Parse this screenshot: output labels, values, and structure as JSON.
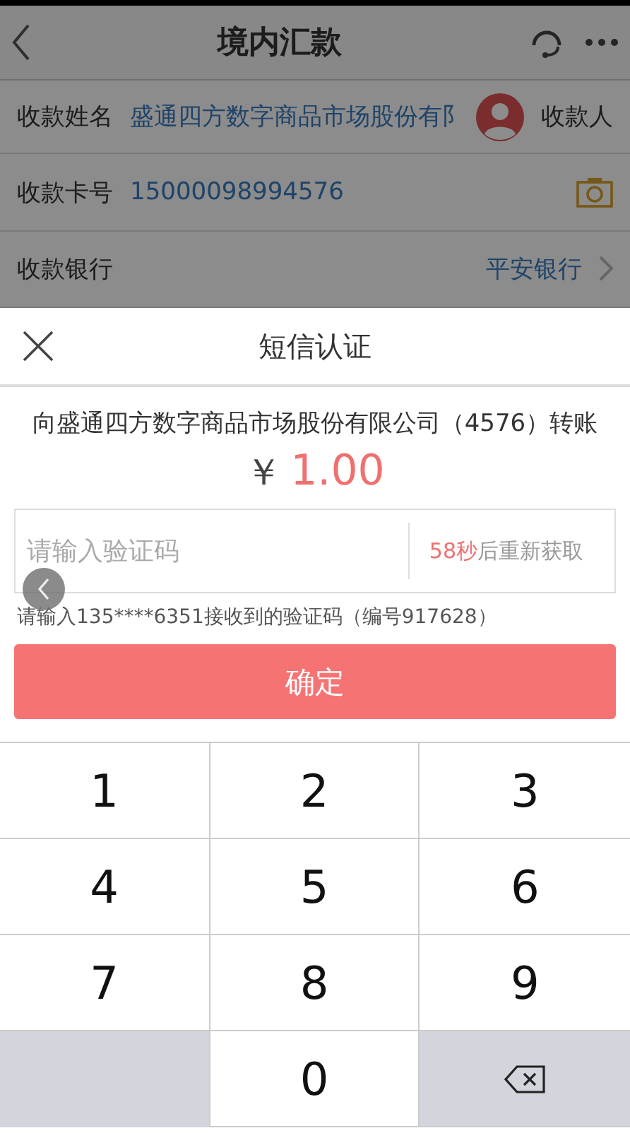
{
  "nav": {
    "title": "境内汇款"
  },
  "form_rows": [
    {
      "kind": "payee",
      "label": "收款姓名",
      "value": "盛通四方数字商品市场股份有阝",
      "action": "收款人"
    },
    {
      "kind": "card",
      "label": "收款卡号",
      "value": "15000098994576"
    },
    {
      "kind": "bank",
      "label": "收款银行",
      "value": "平安银行"
    }
  ],
  "sheet": {
    "title": "短信认证",
    "description": "向盛通四方数字商品市场股份有限公司（4576）转账",
    "currency": "￥",
    "amount": "1.00",
    "code_field": {
      "placeholder": "请输入验证码",
      "countdown": "58秒",
      "resend": "后重新获取"
    },
    "hint": "请输入135****6351接收到的验证码（编号917628）",
    "confirm": "确定"
  },
  "keypad": [
    {
      "kind": "digit",
      "label": "1"
    },
    {
      "kind": "digit",
      "label": "2"
    },
    {
      "kind": "digit",
      "label": "3"
    },
    {
      "kind": "digit",
      "label": "4"
    },
    {
      "kind": "digit",
      "label": "5"
    },
    {
      "kind": "digit",
      "label": "6"
    },
    {
      "kind": "digit",
      "label": "7"
    },
    {
      "kind": "digit",
      "label": "8"
    },
    {
      "kind": "digit",
      "label": "9"
    },
    {
      "kind": "blank"
    },
    {
      "kind": "digit",
      "label": "0"
    },
    {
      "kind": "backspace"
    }
  ]
}
